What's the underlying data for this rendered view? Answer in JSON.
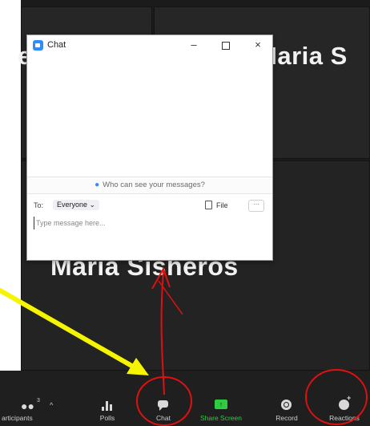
{
  "meeting": {
    "participant_top_right": "Maria S",
    "participant_top_left_fragment": "e",
    "participant_center": "Maria Sisheros"
  },
  "chat_window": {
    "title": "Chat",
    "minimize_symbol": "–",
    "close_symbol": "×",
    "who_can_see": "Who can see your messages?",
    "to_label": "To:",
    "recipient": "Everyone ⌄",
    "file_label": "File",
    "more_label": "···",
    "message_placeholder": "Type message here..."
  },
  "toolbar": {
    "participants_label": "articipants",
    "participants_count": "3",
    "participants_caret": "^",
    "polls_label": "Polls",
    "chat_label": "Chat",
    "share_label": "Share Screen",
    "share_icon": "↑",
    "record_label": "Record",
    "reactions_label": "Reactions"
  },
  "annotations": {
    "arrow_color": "#f5f500",
    "circle_color": "#e01010"
  },
  "colors": {
    "accent_blue": "#2d8cff",
    "share_green": "#2ecc40"
  }
}
